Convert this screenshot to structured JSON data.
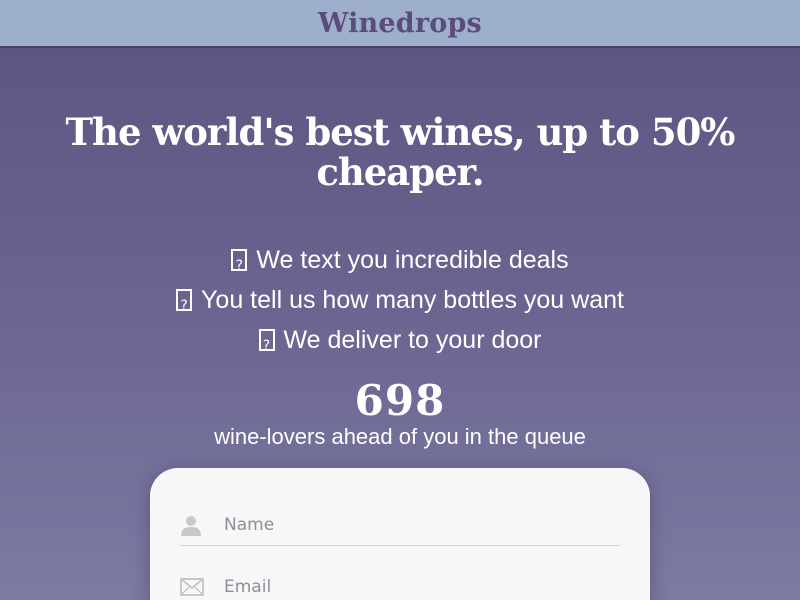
{
  "header": {
    "brand": "Winedrops"
  },
  "hero": {
    "headline": "The world's best wines, up to 50% cheaper.",
    "steps": [
      {
        "icon": "missing-glyph-icon",
        "text": "We text you incredible deals"
      },
      {
        "icon": "missing-glyph-icon",
        "text": "You tell us how many bottles you want"
      },
      {
        "icon": "missing-glyph-icon",
        "text": "We deliver to your door"
      }
    ],
    "queue_count": "698",
    "queue_label": "wine-lovers ahead of you in the queue"
  },
  "form": {
    "name_placeholder": "Name",
    "email_placeholder": "Email",
    "icons": {
      "name": "user-icon",
      "email": "envelope-icon"
    }
  },
  "colors": {
    "header_bg": "#9dafcb",
    "brand": "#5a4d7d",
    "bg_top": "#5c5280",
    "bg_bottom": "#7b7ba3",
    "card_bg": "#f7f7f7"
  }
}
